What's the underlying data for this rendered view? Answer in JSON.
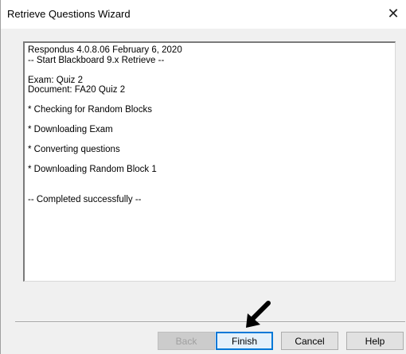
{
  "window": {
    "title": "Retrieve Questions Wizard",
    "close_glyph": "✕"
  },
  "log": {
    "lines": [
      "Respondus 4.0.8.06  February 6, 2020",
      "-- Start Blackboard 9.x Retrieve --",
      "",
      "Exam: Quiz 2",
      "Document: FA20 Quiz 2",
      "",
      "* Checking for Random Blocks",
      "",
      "* Downloading Exam",
      "",
      "* Converting questions",
      "",
      "* Downloading Random Block 1",
      "",
      "",
      "-- Completed successfully --"
    ]
  },
  "buttons": {
    "back": "Back",
    "finish": "Finish",
    "cancel": "Cancel",
    "help": "Help"
  },
  "icons": {
    "close": "close-icon",
    "pointer": "arrow-pointer-icon"
  },
  "colors": {
    "default_button_border": "#0078d7",
    "disabled_text": "#a0a0a0"
  }
}
